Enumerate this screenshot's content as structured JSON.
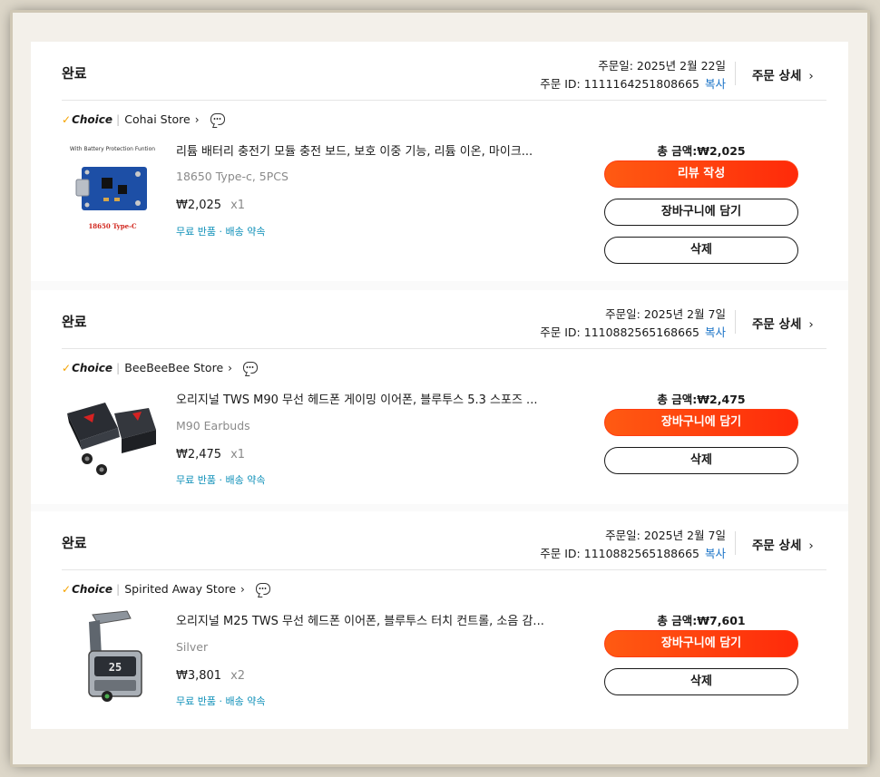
{
  "orders": [
    {
      "status": "완료",
      "order_date": "주문일: 2025년 2월 22일",
      "order_id_label": "주문 ID: 1111164251808665",
      "copy_label": "복사",
      "detail_label": "주문 상세",
      "choice_label": "Choice",
      "store_name": "Cohai Store",
      "thumb_top_text": "With Battery Protection Funtion",
      "thumb_bottom_text": "18650 Type-C",
      "title": "리튬 배터리 충전기 모듈 충전 보드, 보호 이중 기능, 리튬 이온, 마이크...",
      "variant": "18650 Type-c, 5PCS",
      "unit_price": "₩2,025",
      "quantity": "x1",
      "service": "무료 반품 · 배송 약속",
      "total": "총 금액:₩2,025",
      "buttons": [
        "리뷰 작성",
        "장바구니에 담기",
        "삭제"
      ]
    },
    {
      "status": "완료",
      "order_date": "주문일: 2025년 2월 7일",
      "order_id_label": "주문 ID: 1110882565168665",
      "copy_label": "복사",
      "detail_label": "주문 상세",
      "choice_label": "Choice",
      "store_name": "BeeBeeBee Store",
      "title": "오리지널 TWS M90 무선 헤드폰 게이밍 이어폰, 블루투스 5.3 스포즈 ...",
      "variant": "M90 Earbuds",
      "unit_price": "₩2,475",
      "quantity": "x1",
      "service": "무료 반품 · 배송 약속",
      "total": "총 금액:₩2,475",
      "buttons": [
        "장바구니에 담기",
        "삭제"
      ]
    },
    {
      "status": "완료",
      "order_date": "주문일: 2025년 2월 7일",
      "order_id_label": "주문 ID: 1110882565188665",
      "copy_label": "복사",
      "detail_label": "주문 상세",
      "choice_label": "Choice",
      "store_name": "Spirited Away Store",
      "title": "오리지널 M25 TWS 무선 헤드폰 이어폰, 블루투스 터치 컨트롤, 소음 감...",
      "variant": "Silver",
      "unit_price": "₩3,801",
      "quantity": "x2",
      "service": "무료 반품 · 배송 약속",
      "total": "총 금액:₩7,601",
      "buttons": [
        "장바구니에 담기",
        "삭제"
      ]
    }
  ],
  "colors": {
    "accent": "#ff4a10",
    "link": "#1a73c7",
    "service": "#0d8fb8",
    "choice_tick": "#f5a300"
  }
}
